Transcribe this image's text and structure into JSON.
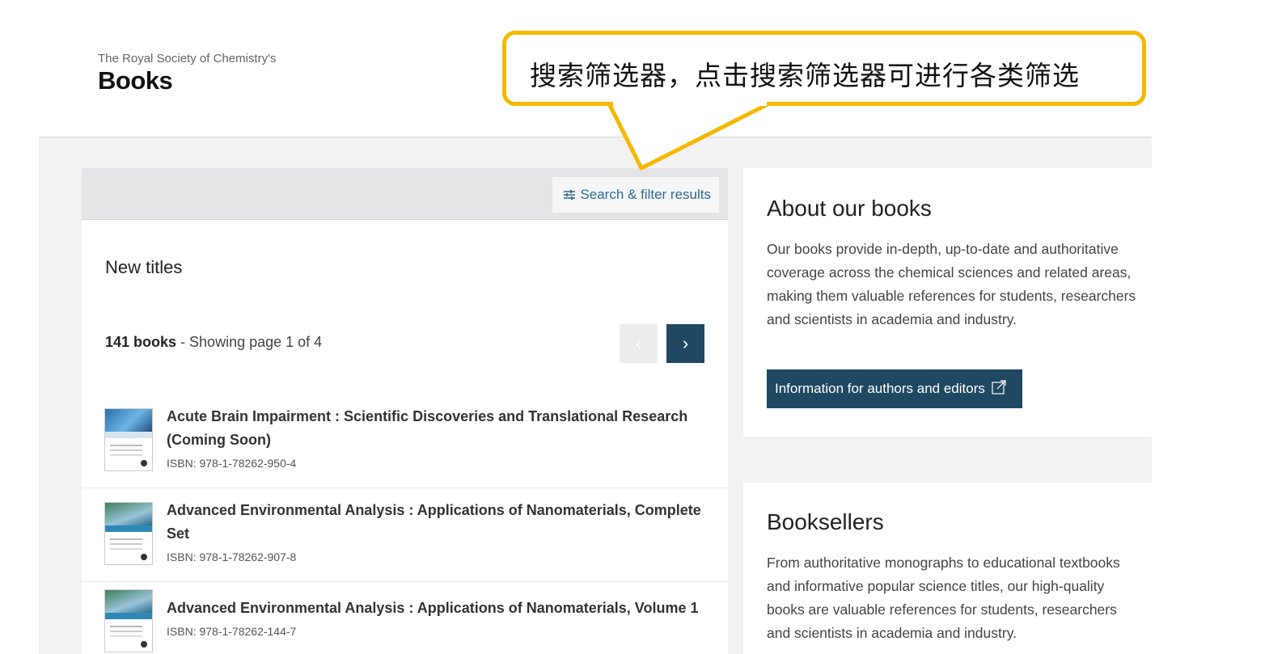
{
  "header": {
    "brand_subtitle": "The Royal Society of Chemistry's",
    "brand_title": "Books"
  },
  "callout": {
    "text": "搜索筛选器，点击搜索筛选器可进行各类筛选",
    "border_color": "#f5b800"
  },
  "filter": {
    "label": "Search & filter results",
    "icon": "sliders-icon"
  },
  "main": {
    "section_title": "New titles",
    "count": "141 books",
    "page_info": " - Showing page 1 of 4",
    "pager": {
      "prev_icon": "chevron-left-icon",
      "next_icon": "chevron-right-icon"
    },
    "books": [
      {
        "title": "Acute Brain Impairment : Scientific Discoveries and Translational Research (Coming Soon)",
        "isbn": "ISBN: 978-1-78262-950-4"
      },
      {
        "title": "Advanced Environmental Analysis : Applications of Nanomaterials, Complete Set",
        "isbn": "ISBN: 978-1-78262-907-8"
      },
      {
        "title": "Advanced Environmental Analysis : Applications of Nanomaterials, Volume 1",
        "isbn": "ISBN: 978-1-78262-144-7"
      }
    ]
  },
  "sidebar": {
    "about": {
      "heading": "About our books",
      "text": "Our books provide in-depth, up-to-date and authoritative coverage across the chemical sciences and related areas, making them valuable references for students, researchers and scientists in academia and industry.",
      "button_label": "Information for authors and editors",
      "button_icon": "external-link-icon"
    },
    "booksellers": {
      "heading": "Booksellers",
      "text": "From authoritative monographs to educational textbooks and informative popular science titles, our high-quality books are valuable references for students, researchers and scientists in academia and industry."
    }
  },
  "colors": {
    "accent_dark": "#1f4862",
    "link": "#2f6c95",
    "page_grey": "#f2f2f3"
  }
}
